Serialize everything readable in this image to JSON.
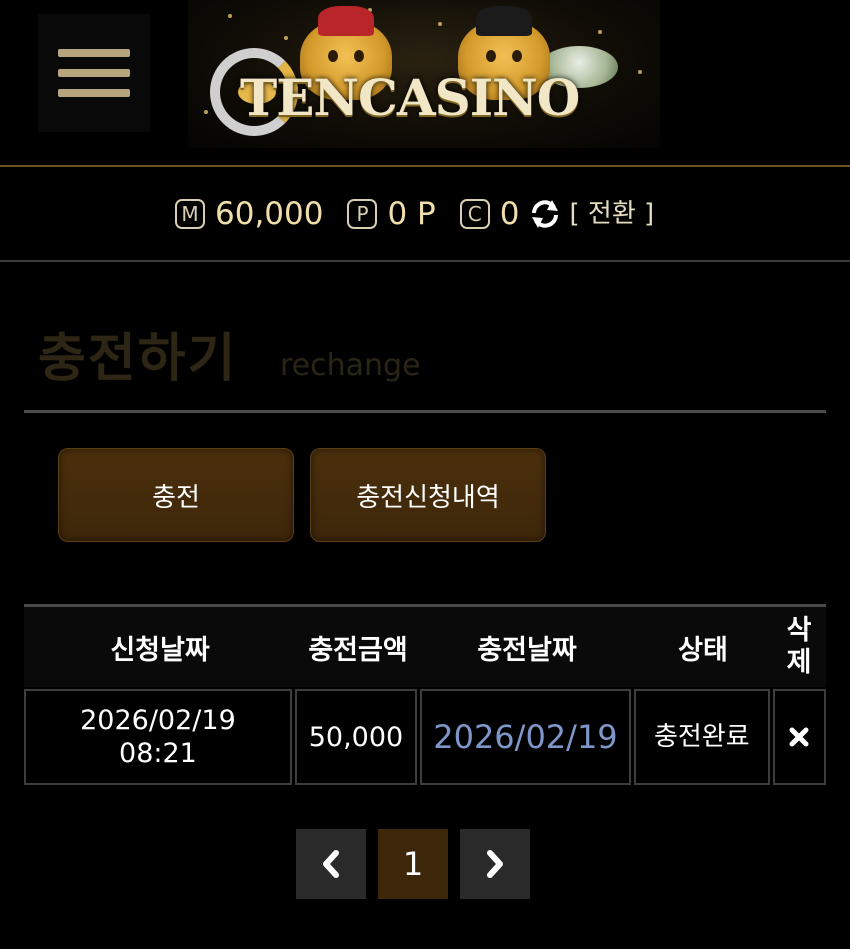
{
  "header": {
    "logo_text": "TENCASINO",
    "menu_icon": "hamburger-menu-icon"
  },
  "balance": {
    "money_badge": "M",
    "money_value": "60,000",
    "point_badge": "P",
    "point_value": "0 P",
    "casino_badge": "C",
    "casino_value": "0",
    "refresh_icon": "refresh-icon",
    "switch_label": "[ 전환 ]"
  },
  "page": {
    "title": "충전하기",
    "subtitle": "rechange"
  },
  "tabs": {
    "charge_label": "충전",
    "history_label": "충전신청내역"
  },
  "table": {
    "headers": [
      "신청날짜",
      "충전금액",
      "충전날짜",
      "상태",
      "삭제"
    ],
    "rows": [
      {
        "request_date": "2026/02/19",
        "request_time": "08:21",
        "amount": "50,000",
        "charge_date": "2026/02/19",
        "status": "충전완료",
        "delete_icon": "close-icon"
      }
    ]
  },
  "pagination": {
    "prev_icon": "chevron-left-icon",
    "current": "1",
    "next_icon": "chevron-right-icon"
  },
  "colors": {
    "background": "#000000",
    "gold_text": "#f0deab",
    "button_bg": "#4b300c",
    "link_blue": "#7d97c9",
    "border_gray": "#3d3d3d"
  }
}
